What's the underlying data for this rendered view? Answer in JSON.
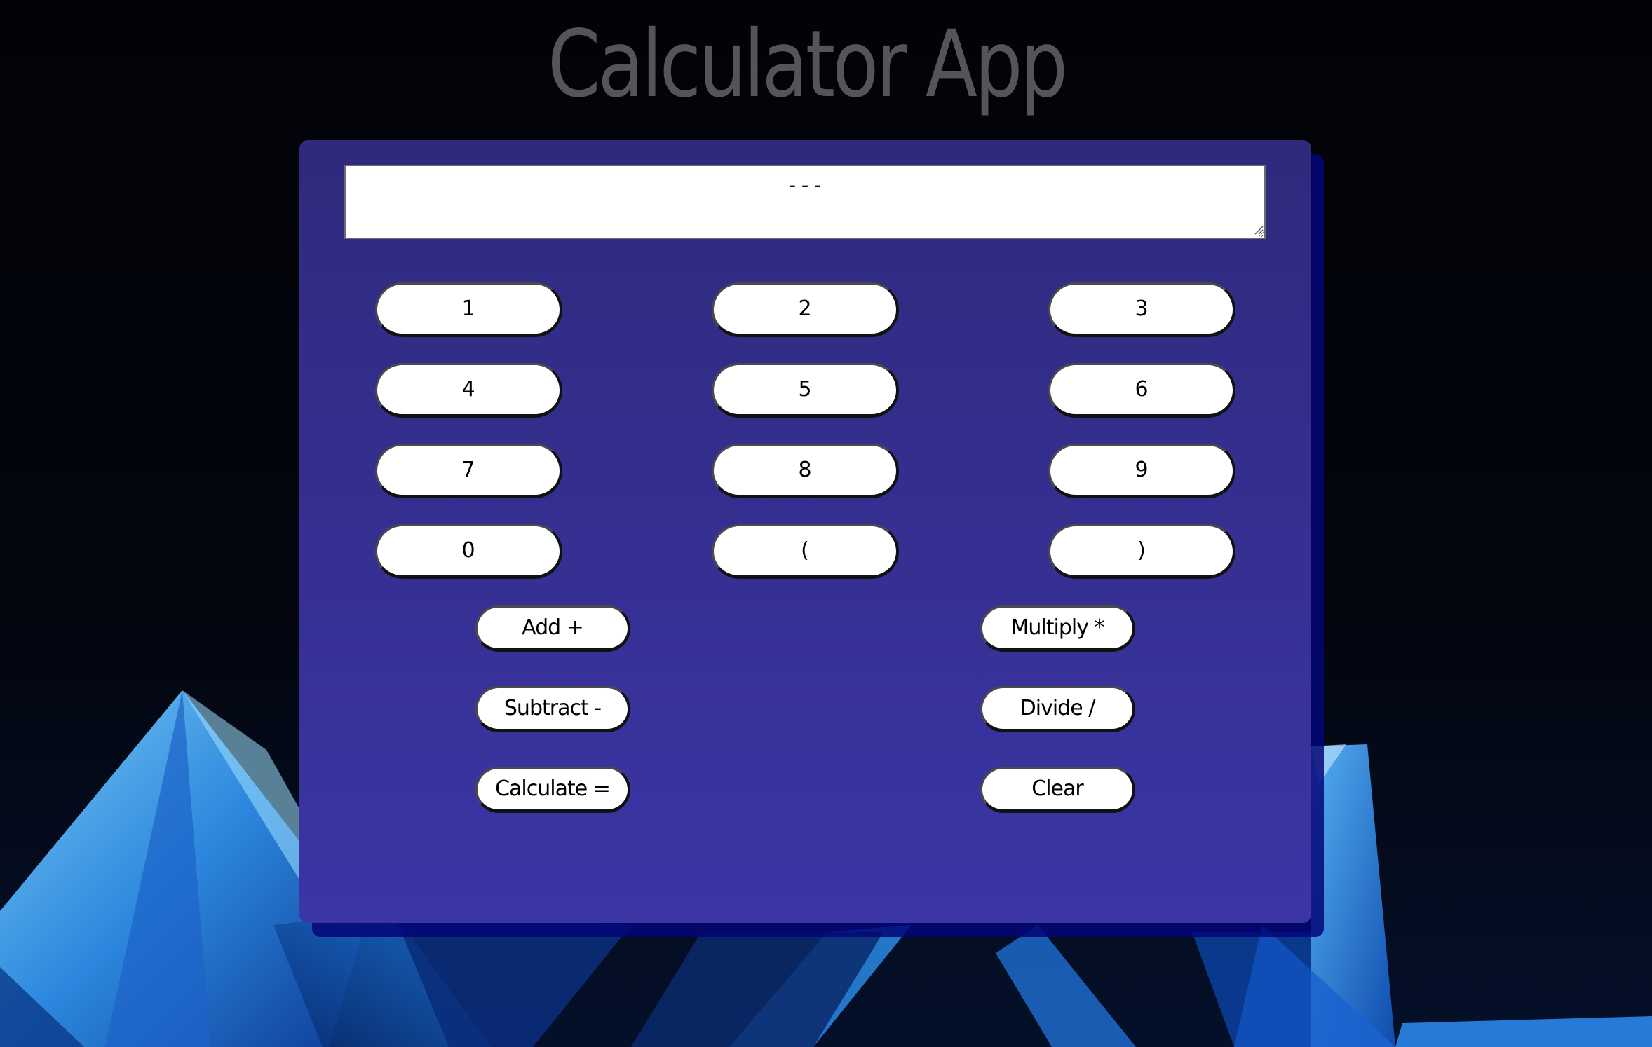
{
  "app": {
    "title": "Calculator App"
  },
  "display": {
    "value": "---"
  },
  "keypad": {
    "digits": [
      {
        "name": "digit-1-button",
        "label": "1"
      },
      {
        "name": "digit-2-button",
        "label": "2"
      },
      {
        "name": "digit-3-button",
        "label": "3"
      },
      {
        "name": "digit-4-button",
        "label": "4"
      },
      {
        "name": "digit-5-button",
        "label": "5"
      },
      {
        "name": "digit-6-button",
        "label": "6"
      },
      {
        "name": "digit-7-button",
        "label": "7"
      },
      {
        "name": "digit-8-button",
        "label": "8"
      },
      {
        "name": "digit-9-button",
        "label": "9"
      },
      {
        "name": "digit-0-button",
        "label": "0"
      },
      {
        "name": "open-paren-button",
        "label": "("
      },
      {
        "name": "close-paren-button",
        "label": ")"
      }
    ],
    "operations": [
      {
        "name": "add-button",
        "label": "Add +"
      },
      {
        "name": "multiply-button",
        "label": "Multiply *"
      },
      {
        "name": "subtract-button",
        "label": "Subtract -"
      },
      {
        "name": "divide-button",
        "label": "Divide /"
      },
      {
        "name": "calculate-button",
        "label": "Calculate ="
      },
      {
        "name": "clear-button",
        "label": "Clear"
      }
    ]
  },
  "colors": {
    "card_top": "#2f2a7c",
    "card_bottom": "#3b35a6",
    "card_shadow": "#040678",
    "title": "#555558",
    "crystal": "#2f8ee8"
  }
}
